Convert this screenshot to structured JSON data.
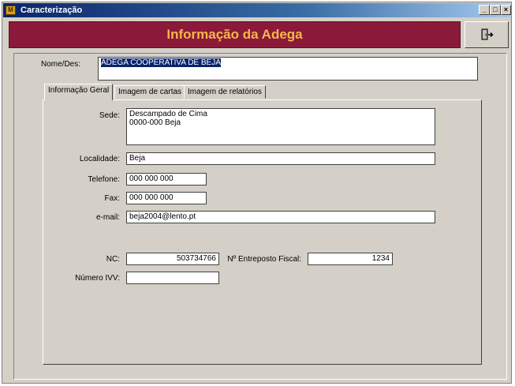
{
  "window": {
    "title": "Caracterização",
    "app_icon": "winery-app-icon"
  },
  "header": {
    "title": "Informação da Adega",
    "exit_icon": "exit-door-icon"
  },
  "form": {
    "nome_label": "Nome/Des:",
    "nome_value": "ADEGA COOPERATIVA DE BEJA"
  },
  "tabs": [
    {
      "label": "Informação Geral",
      "active": true
    },
    {
      "label": "Imagem de cartas",
      "active": false
    },
    {
      "label": "Imagem de relatórios",
      "active": false
    }
  ],
  "general": {
    "sede_label": "Sede:",
    "sede_line1": "Descampado de Cima",
    "sede_line2": "0000-000 Beja",
    "localidade_label": "Localidade:",
    "localidade_value": "Beja",
    "telefone_label": "Telefone:",
    "telefone_value": "000 000 000",
    "fax_label": "Fax:",
    "fax_value": "000 000 000",
    "email_label": "e-mail:",
    "email_value": "beja2004@lento.pt",
    "nc_label": "NC:",
    "nc_value": "503734766",
    "entreposto_label": "Nº Entreposto Fiscal:",
    "entreposto_value": "1234",
    "ivv_label": "Número IVV:",
    "ivv_value": ""
  },
  "colors": {
    "header_bg": "#8b1a3a",
    "header_text": "#f5b84a",
    "window_bg": "#d4d0c8"
  }
}
